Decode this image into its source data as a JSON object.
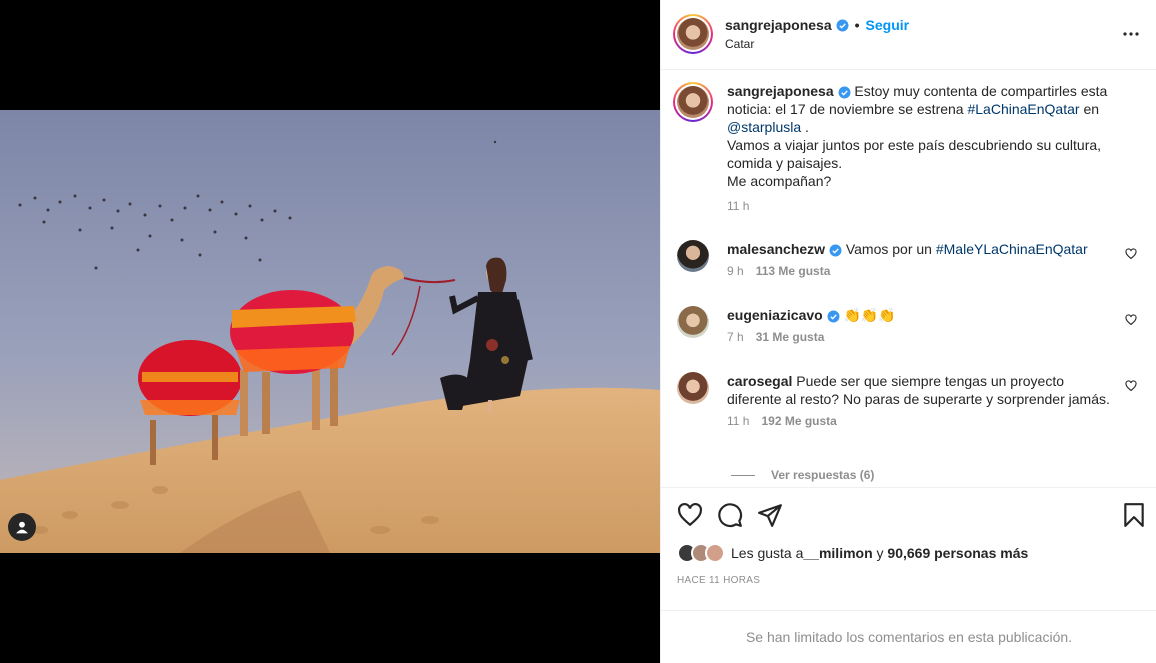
{
  "post": {
    "username": "sangrejaponesa",
    "separator": "•",
    "follow_label": "Seguir",
    "location": "Catar"
  },
  "caption": {
    "username": "sangrejaponesa",
    "text_part1": "Estoy muy contenta de compartirles esta noticia: el 17 de noviembre se estrena ",
    "hashtag": "#LaChinaEnQatar",
    "text_part2": " en ",
    "mention": "@starplusla",
    "text_part3": " .",
    "line2": "Vamos a viajar juntos por este país descubriendo su cultura, comida y paisajes.",
    "line3": "Me acompañan?",
    "time": "11 h"
  },
  "comments": [
    {
      "username": "malesanchezw",
      "verified": true,
      "text_before": "Vamos por un ",
      "hashtag": "#MaleYLaChinaEnQatar",
      "time": "9 h",
      "likes": "113 Me gusta"
    },
    {
      "username": "eugeniazicavo",
      "verified": true,
      "text": "👏👏👏",
      "time": "7 h",
      "likes": "31 Me gusta"
    },
    {
      "username": "carosegal",
      "verified": false,
      "text": "Puede ser que siempre tengas un proyecto diferente al resto? No paras de superarte y sorprender jamás.",
      "time": "11 h",
      "likes": "192 Me gusta"
    }
  ],
  "replies_label": "Ver respuestas (6)",
  "likes": {
    "prefix": "Les gusta a ",
    "user": "__milimon",
    "mid": " y ",
    "others": "90,669 personas más"
  },
  "posted_ago": "HACE 11 HORAS",
  "footer_text": "Se han limitado los comentarios en esta publicación.",
  "colors": {
    "accent": "#0095f6",
    "link": "#00376b",
    "muted": "#8e8e8e",
    "verified": "#3897f0"
  },
  "icons": [
    "verified-badge-icon",
    "more-options-icon",
    "heart-icon",
    "comment-icon",
    "share-icon",
    "bookmark-icon",
    "user-tag-icon"
  ]
}
